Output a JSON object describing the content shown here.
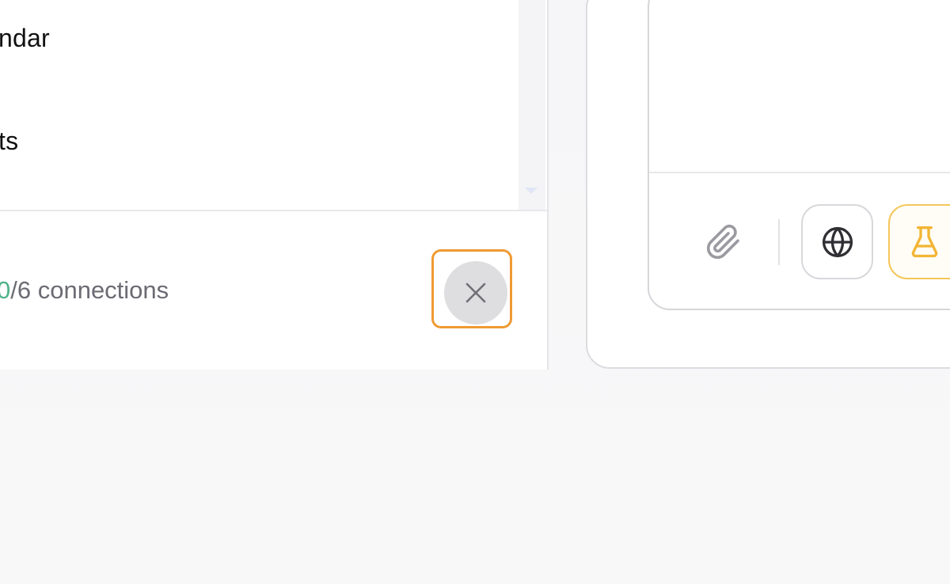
{
  "connections_panel": {
    "items": [
      {
        "label": "ndar"
      },
      {
        "label": "ts"
      }
    ],
    "footer": {
      "count_current": "0",
      "count_rest": "/6 connections"
    },
    "close_button": {
      "icon": "close-icon",
      "highlighted": true,
      "highlight_color": "#ef9a33"
    }
  },
  "composer": {
    "toolbar": {
      "attach": {
        "icon": "paperclip-icon"
      },
      "web_search": {
        "icon": "globe-icon"
      },
      "research": {
        "icon": "flask-icon",
        "active": true,
        "accent_color": "#f2b534"
      }
    }
  },
  "colors": {
    "count_accent": "#4fb38a",
    "muted_text": "#6b6b73",
    "highlight": "#ef9a33"
  }
}
